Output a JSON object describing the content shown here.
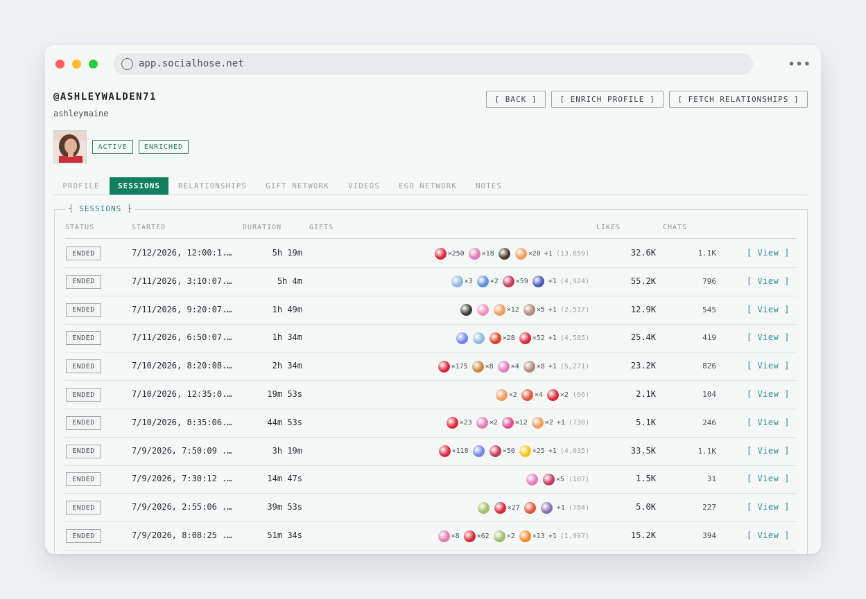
{
  "browser": {
    "url": "app.socialhose.net"
  },
  "profile": {
    "handle": "@ASHLEYWALDEN71",
    "username": "ashleymaine",
    "badges": [
      "ACTIVE",
      "ENRICHED"
    ]
  },
  "actions": {
    "back": "[ BACK ]",
    "enrich": "[ ENRICH PROFILE ]",
    "fetch": "[ FETCH RELATIONSHIPS ]"
  },
  "tabs": [
    "PROFILE",
    "SESSIONS",
    "RELATIONSHIPS",
    "GIFT NETWORK",
    "VIDEOS",
    "EGO NETWORK",
    "NOTES"
  ],
  "active_tab": "SESSIONS",
  "sessions": {
    "legend_left": "┤",
    "legend": "SESSIONS",
    "legend_right": "├",
    "columns": {
      "status": "STATUS",
      "started": "STARTED",
      "duration": "DURATION",
      "gifts": "GIFTS",
      "likes": "LIKES",
      "chats": "CHATS"
    },
    "rows": [
      {
        "status": "ENDED",
        "started": "7/12/2026, 12:00:1...",
        "duration": "5h 19m",
        "gifts": [
          {
            "icon": "rose-gift-icon",
            "color": "#d8283a",
            "count": "×250"
          },
          {
            "icon": "heart-box-gift-icon",
            "color": "#e27bb7",
            "count": "×18"
          },
          {
            "icon": "hat-gift-icon",
            "color": "#4a3a33",
            "count": ""
          },
          {
            "icon": "donut-gift-icon",
            "color": "#f29a5c",
            "count": "×20"
          }
        ],
        "plus": "+1",
        "total": "(13,859)",
        "likes": "32.6K",
        "chats": "1.1K",
        "view": "[ View ]"
      },
      {
        "status": "ENDED",
        "started": "7/11/2026, 3:10:07...",
        "duration": "5h 4m",
        "gifts": [
          {
            "icon": "feather-gift-icon",
            "color": "#8fb8e0",
            "count": "×3"
          },
          {
            "icon": "snowflake-gift-icon",
            "color": "#5f8fd6",
            "count": "×2"
          },
          {
            "icon": "heart-photo-gift-icon",
            "color": "#c33a5a",
            "count": "×59"
          },
          {
            "icon": "shark-gift-icon",
            "color": "#4b59b8",
            "count": ""
          }
        ],
        "plus": "+1",
        "total": "(4,924)",
        "likes": "55.2K",
        "chats": "796",
        "view": "[ View ]"
      },
      {
        "status": "ENDED",
        "started": "7/11/2026, 9:20:07...",
        "duration": "1h 49m",
        "gifts": [
          {
            "icon": "camera-gift-icon",
            "color": "#3b3b3b",
            "count": ""
          },
          {
            "icon": "bow-gift-icon",
            "color": "#ee8fc4",
            "count": ""
          },
          {
            "icon": "donut-gift-icon",
            "color": "#f29a5c",
            "count": "×12"
          },
          {
            "icon": "face-gift-icon",
            "color": "#b08a7a",
            "count": "×5"
          }
        ],
        "plus": "+1",
        "total": "(2,517)",
        "likes": "12.9K",
        "chats": "545",
        "view": "[ View ]"
      },
      {
        "status": "ENDED",
        "started": "7/11/2026, 6:50:07...",
        "duration": "1h 34m",
        "gifts": [
          {
            "icon": "crystal-gift-icon",
            "color": "#6f86e6",
            "count": ""
          },
          {
            "icon": "feather-gift-icon",
            "color": "#8fb8e0",
            "count": ""
          },
          {
            "icon": "chili-gift-icon",
            "color": "#d8431f",
            "count": "×28"
          },
          {
            "icon": "rose-gift-icon",
            "color": "#d8283a",
            "count": "×52"
          }
        ],
        "plus": "+1",
        "total": "(4,585)",
        "likes": "25.4K",
        "chats": "419",
        "view": "[ View ]"
      },
      {
        "status": "ENDED",
        "started": "7/10/2026, 8:20:08...",
        "duration": "2h 34m",
        "gifts": [
          {
            "icon": "rose-gift-icon",
            "color": "#d8283a",
            "count": "×175"
          },
          {
            "icon": "hat-gift-icon",
            "color": "#c88a3e",
            "count": "×8"
          },
          {
            "icon": "heart-box-gift-icon",
            "color": "#e27bb7",
            "count": "×4"
          },
          {
            "icon": "face-gift-icon",
            "color": "#b08a7a",
            "count": "×8"
          }
        ],
        "plus": "+1",
        "total": "(5,271)",
        "likes": "23.2K",
        "chats": "826",
        "view": "[ View ]"
      },
      {
        "status": "ENDED",
        "started": "7/10/2026, 12:35:0...",
        "duration": "19m 53s",
        "gifts": [
          {
            "icon": "donut-gift-icon",
            "color": "#f29a5c",
            "count": "×2"
          },
          {
            "icon": "crab-gift-icon",
            "color": "#e2553a",
            "count": "×4"
          },
          {
            "icon": "rose-gift-icon",
            "color": "#d8283a",
            "count": "×2"
          }
        ],
        "plus": "",
        "total": "(66)",
        "likes": "2.1K",
        "chats": "104",
        "view": "[ View ]"
      },
      {
        "status": "ENDED",
        "started": "7/10/2026, 8:35:06...",
        "duration": "44m 53s",
        "gifts": [
          {
            "icon": "rose-gift-icon",
            "color": "#d8283a",
            "count": "×23"
          },
          {
            "icon": "heart-box-gift-icon",
            "color": "#e27bb7",
            "count": "×2"
          },
          {
            "icon": "love-sign-gift-icon",
            "color": "#e04f8f",
            "count": "×12"
          },
          {
            "icon": "donut-gift-icon",
            "color": "#f29a5c",
            "count": "×2"
          }
        ],
        "plus": "+1",
        "total": "(730)",
        "likes": "5.1K",
        "chats": "246",
        "view": "[ View ]"
      },
      {
        "status": "ENDED",
        "started": "7/9/2026, 7:50:09 ...",
        "duration": "3h 19m",
        "gifts": [
          {
            "icon": "rose-gift-icon",
            "color": "#d8283a",
            "count": "×118"
          },
          {
            "icon": "crystal-gift-icon",
            "color": "#6f86e6",
            "count": ""
          },
          {
            "icon": "heart-photo-gift-icon",
            "color": "#c33a5a",
            "count": "×50"
          },
          {
            "icon": "lightning-gift-icon",
            "color": "#f5c21a",
            "count": "×25"
          }
        ],
        "plus": "+1",
        "total": "(4,035)",
        "likes": "33.5K",
        "chats": "1.1K",
        "view": "[ View ]"
      },
      {
        "status": "ENDED",
        "started": "7/9/2026, 7:30:12 ...",
        "duration": "14m 47s",
        "gifts": [
          {
            "icon": "heart-box-gift-icon",
            "color": "#e27bb7",
            "count": ""
          },
          {
            "icon": "heart-photo-gift-icon",
            "color": "#c33a5a",
            "count": "×5"
          }
        ],
        "plus": "",
        "total": "(107)",
        "likes": "1.5K",
        "chats": "31",
        "view": "[ View ]"
      },
      {
        "status": "ENDED",
        "started": "7/9/2026, 2:55:06 ...",
        "duration": "39m 53s",
        "gifts": [
          {
            "icon": "wreath-gift-icon",
            "color": "#9fbf6a",
            "count": ""
          },
          {
            "icon": "rose-gift-icon",
            "color": "#d8283a",
            "count": "×27"
          },
          {
            "icon": "crab-gift-icon",
            "color": "#e2553a",
            "count": ""
          },
          {
            "icon": "cupcake-gift-icon",
            "color": "#8a6fb0",
            "count": ""
          }
        ],
        "plus": "+1",
        "total": "(784)",
        "likes": "5.0K",
        "chats": "227",
        "view": "[ View ]"
      },
      {
        "status": "ENDED",
        "started": "7/9/2026, 8:08:25 ...",
        "duration": "51m 34s",
        "gifts": [
          {
            "icon": "heart-box-gift-icon",
            "color": "#e27bb7",
            "count": "×8"
          },
          {
            "icon": "rose-gift-icon",
            "color": "#d8283a",
            "count": "×62"
          },
          {
            "icon": "wreath-gift-icon",
            "color": "#9fbf6a",
            "count": "×2"
          },
          {
            "icon": "flame-gift-icon",
            "color": "#f08a2a",
            "count": "×13"
          }
        ],
        "plus": "+1",
        "total": "(1,997)",
        "likes": "15.2K",
        "chats": "394",
        "view": "[ View ]"
      }
    ]
  }
}
